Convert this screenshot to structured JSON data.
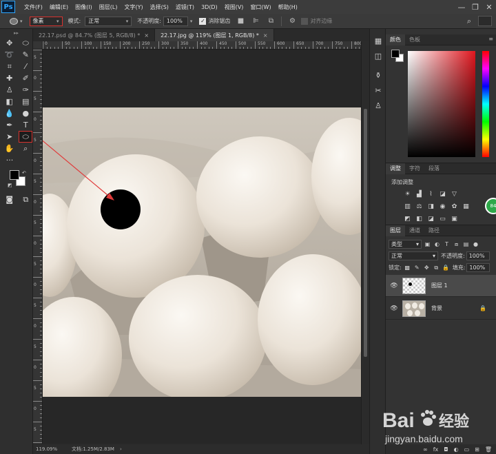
{
  "app": {
    "logo": "Ps"
  },
  "menu": [
    "文件(F)",
    "编辑(E)",
    "图像(I)",
    "图层(L)",
    "文字(Y)",
    "选择(S)",
    "滤镜(T)",
    "3D(D)",
    "视图(V)",
    "窗口(W)",
    "帮助(H)"
  ],
  "window_controls": {
    "minimize": "—",
    "restore": "❐",
    "close": "✕"
  },
  "options": {
    "tool_icon": "ellipse-tool-icon",
    "pixel_value": "像素",
    "mode_label": "模式:",
    "mode_value": "正常",
    "opacity_label": "不透明度:",
    "opacity_value": "100%",
    "antialias_label": "消除锯齿",
    "antialias_checked": "✓",
    "align_edges": "对齐边缘"
  },
  "tabs": [
    {
      "label": "22.17.psd @ 84.7% (图层 5, RGB/8) *",
      "close": "×"
    },
    {
      "label": "22.17.jpg @ 119% (图层 1, RGB/8) *",
      "close": "×"
    }
  ],
  "ruler": {
    "h_labels": [
      "0",
      "50",
      "100",
      "150",
      "200",
      "250",
      "300",
      "350",
      "400",
      "450",
      "500",
      "550",
      "600",
      "650",
      "700",
      "750",
      "800"
    ],
    "v_labels": [
      "5",
      "0",
      "5",
      "0",
      "5",
      "0",
      "5",
      "0",
      "5",
      "0",
      "5",
      "0",
      "5",
      "0",
      "5",
      "0",
      "5",
      "0",
      "5"
    ]
  },
  "status": {
    "zoom": "119.09%",
    "doc_info": "文档:1.25M/2.83M",
    "arrow": "›"
  },
  "tools": [
    [
      "move-tool-icon",
      "marquee-tool-icon"
    ],
    [
      "lasso-tool-icon",
      "quick-select-tool-icon"
    ],
    [
      "crop-tool-icon",
      "eyedropper-tool-icon"
    ],
    [
      "healing-tool-icon",
      "brush-tool-icon"
    ],
    [
      "stamp-tool-icon",
      "history-brush-tool-icon"
    ],
    [
      "eraser-tool-icon",
      "gradient-tool-icon"
    ],
    [
      "blur-tool-icon",
      "dodge-tool-icon"
    ],
    [
      "pen-tool-icon",
      "type-tool-icon"
    ],
    [
      "path-select-tool-icon",
      "ellipse-tool-icon"
    ],
    [
      "hand-tool-icon",
      "zoom-tool-icon"
    ]
  ],
  "color_panel": {
    "tabs": [
      "颜色",
      "色板"
    ],
    "menu": "≡"
  },
  "adjust_panel": {
    "tabs": [
      "调整",
      "字符",
      "段落"
    ],
    "title": "添加调整",
    "badge": "84"
  },
  "layers_panel": {
    "tabs": [
      "图层",
      "通道",
      "路径"
    ],
    "kind_label": "类型",
    "blend_mode": "正常",
    "opacity_label": "不透明度:",
    "opacity_value": "100%",
    "lock_label": "锁定:",
    "fill_label": "填充:",
    "fill_value": "100%",
    "layers": [
      {
        "name": "图层 1",
        "selected": true
      },
      {
        "name": "背景",
        "selected": false,
        "locked": true
      }
    ]
  },
  "watermark": {
    "brand": "Bai",
    "brand_suffix": "经验",
    "url": "jingyan.baidu.com"
  },
  "colors": {
    "accent_red": "#d9322e",
    "foreground": "#000000",
    "background": "#ffffff"
  }
}
